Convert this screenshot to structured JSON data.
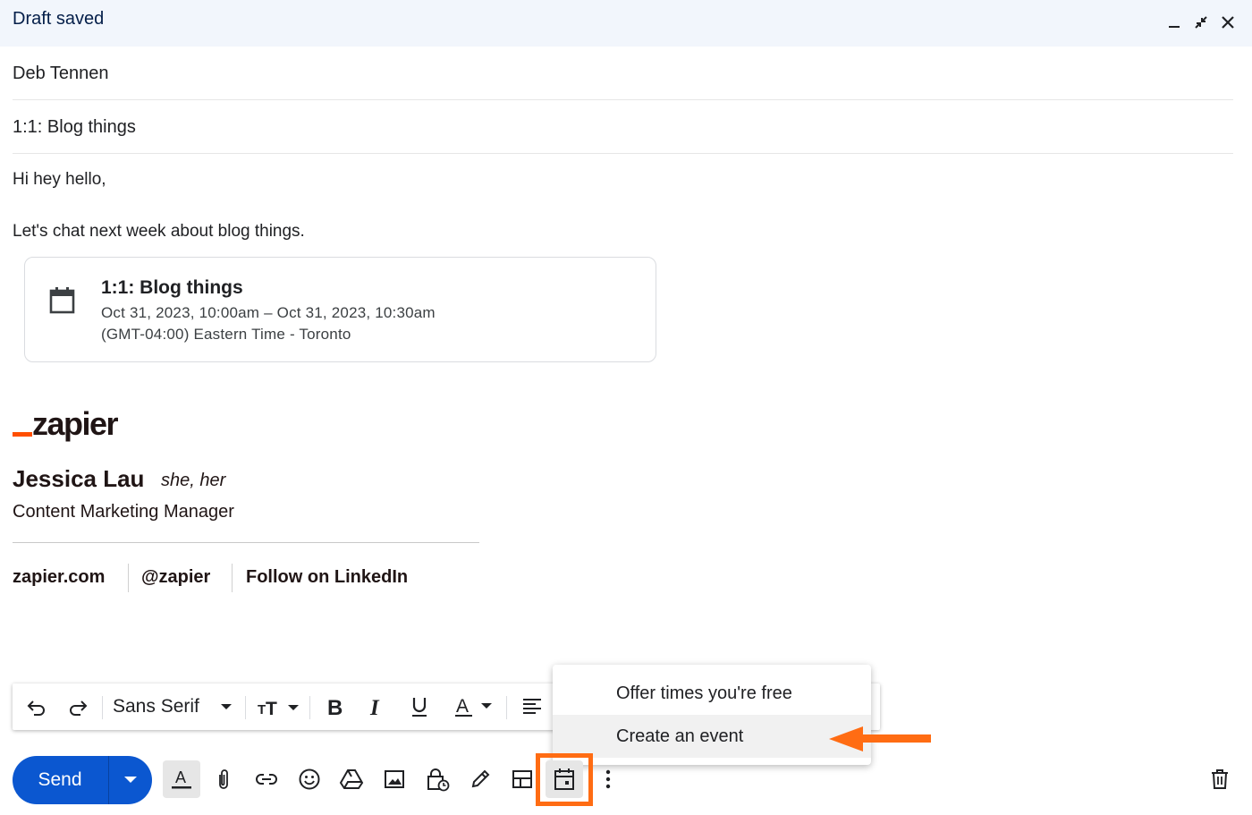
{
  "window": {
    "title": "Draft saved"
  },
  "compose": {
    "to": "Deb Tennen",
    "subject": "1:1: Blog things",
    "greeting": "Hi hey hello,",
    "message": "Let's chat next week about blog things."
  },
  "event_card": {
    "icon": "calendar-icon",
    "title": "1:1: Blog things",
    "when": "Oct 31, 2023, 10:00am – Oct 31, 2023, 10:30am",
    "timezone": "(GMT-04:00) Eastern Time - Toronto"
  },
  "signature": {
    "logo_text": "zapier",
    "name": "Jessica Lau",
    "pronouns": "she, her",
    "role": "Content Marketing Manager",
    "links": [
      "zapier.com",
      "@zapier",
      "Follow on LinkedIn"
    ]
  },
  "formatting_toolbar": {
    "font": "Sans Serif",
    "items": [
      "undo-icon",
      "redo-icon",
      "font-size-icon",
      "bold-icon",
      "italic-icon",
      "underline-icon",
      "text-color-icon",
      "align-icon"
    ]
  },
  "event_menu": {
    "items": [
      {
        "label": "Offer times you're free",
        "highlighted": false
      },
      {
        "label": "Create an event",
        "highlighted": true
      }
    ]
  },
  "bottom_toolbar": {
    "send_label": "Send",
    "items": [
      "formatting-icon",
      "attach-icon",
      "link-icon",
      "emoji-icon",
      "drive-icon",
      "image-icon",
      "confidential-icon",
      "signature-icon",
      "template-icon",
      "calendar-event-icon",
      "more-options-icon",
      "trash-icon"
    ]
  },
  "colors": {
    "header_bg": "#f2f6fc",
    "send_button": "#0b57d0",
    "zapier_orange": "#ff4f00",
    "annotation": "#ff6c13"
  }
}
